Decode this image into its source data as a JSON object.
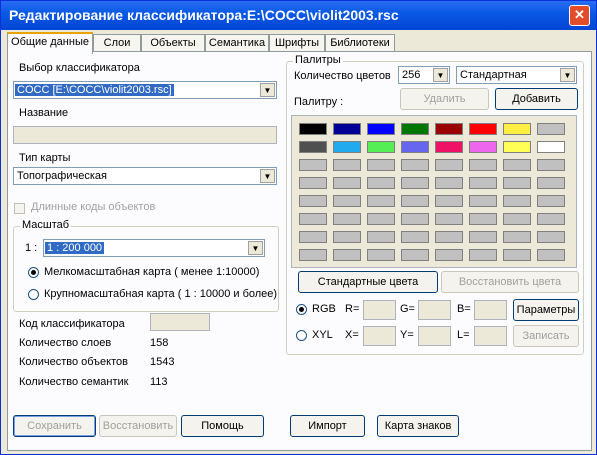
{
  "window": {
    "title": "Редактирование классификатора:E:\\COCC\\violit2003.rsc",
    "close_label": "✕"
  },
  "tabs": [
    {
      "label": "Общие данные",
      "active": true
    },
    {
      "label": "Слои"
    },
    {
      "label": "Объекты"
    },
    {
      "label": "Семантика"
    },
    {
      "label": "Шрифты"
    },
    {
      "label": "Библиотеки"
    }
  ],
  "left": {
    "classifier_label": "Выбор классификатора",
    "classifier_value": "COCC [E:\\COCC\\violit2003.rsc]",
    "name_label": "Название",
    "name_value": "",
    "map_type_label": "Тип карты",
    "map_type_value": "Топографическая",
    "long_codes_label": "Длинные коды объектов",
    "scale_group_label": "Масштаб",
    "scale_prefix": "1 :",
    "scale_value": "1 : 200 000",
    "radio_small": "Мелкомасштабная карта ( менее 1:10000)",
    "radio_large": "Крупномасштабная карта ( 1 : 10000 и более)",
    "code_label": "Код классификатора",
    "code_value": "",
    "stats": [
      {
        "label": "Количество слоев",
        "value": "158"
      },
      {
        "label": "Количество объектов",
        "value": "1543"
      },
      {
        "label": "Количество семантик",
        "value": "113"
      }
    ]
  },
  "palettes": {
    "group_label": "Палитры",
    "count_label": "Количество цветов",
    "count_value": "256",
    "palette_value": "Стандартная",
    "palette_label": "Палитру :",
    "delete_label": "Удалить",
    "add_label": "Добавить",
    "row1": [
      "#000000",
      "#000099",
      "#0000ff",
      "#007700",
      "#990000",
      "#ff0000",
      "#ffee44",
      "#c0c0c0"
    ],
    "row2": [
      "#505050",
      "#22aaee",
      "#55ee55",
      "#6666ee",
      "#ee1166",
      "#ee66ee",
      "#ffff55",
      "#ffffff"
    ],
    "empty_color": "#c0c0c0",
    "standard_colors_label": "Стандартные цвета",
    "restore_colors_label": "Восстановить цвета",
    "rgb_label": "RGB",
    "xyl_label": "XYL",
    "r_label": "R=",
    "g_label": "G=",
    "b_label": "B=",
    "x_label": "X=",
    "y_label": "Y=",
    "l_label": "L=",
    "params_label": "Параметры",
    "write_label": "Записать"
  },
  "bottom": {
    "save_label": "Сохранить",
    "restore_label": "Восстановить",
    "help_label": "Помощь",
    "import_label": "Импорт",
    "signs_map_label": "Карта знаков"
  }
}
